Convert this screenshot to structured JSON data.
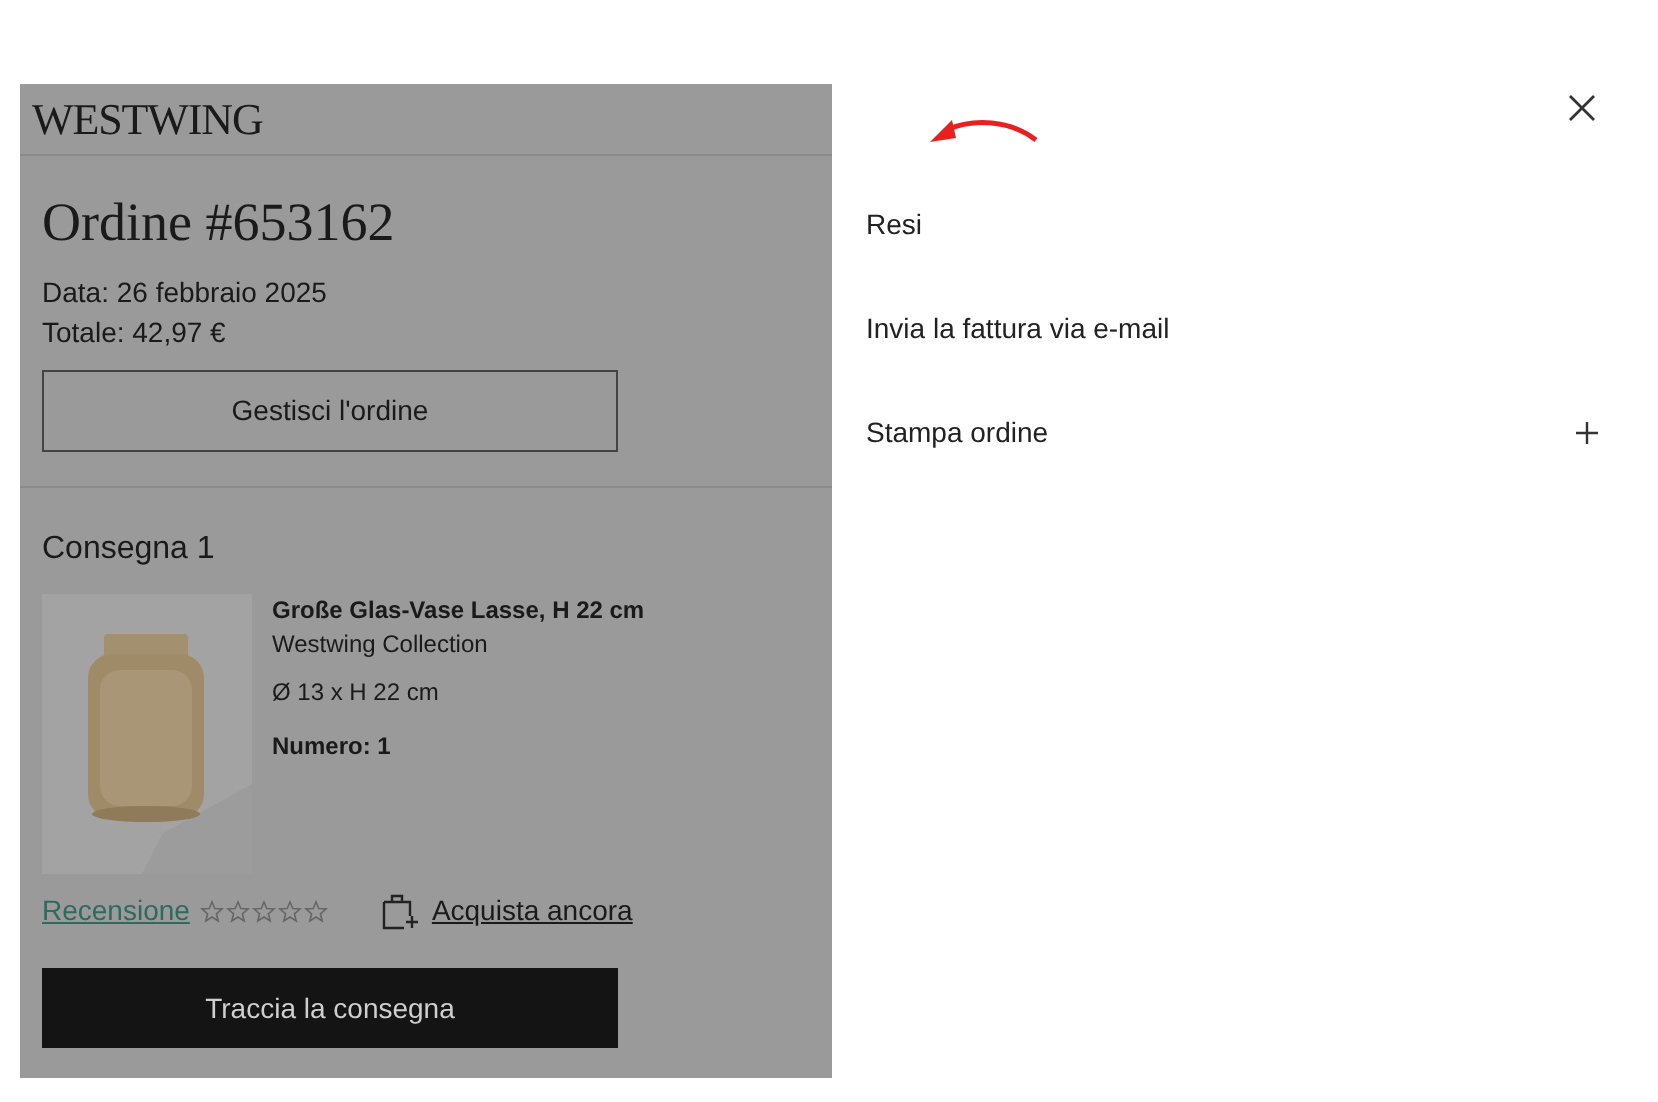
{
  "logo": "WESTWING",
  "order": {
    "title": "Ordine #653162",
    "date": "Data: 26 febbraio 2025",
    "total": "Totale: 42,97 €",
    "manage_button": "Gestisci l'ordine"
  },
  "delivery": {
    "title": "Consegna 1",
    "product": {
      "name": "Große Glas-Vase Lasse, H 22 cm",
      "brand": "Westwing Collection",
      "size": "Ø 13 x H 22 cm",
      "quantity": "Numero: 1"
    },
    "review_link": "Recensione",
    "stars": 0,
    "buy_again_link": "Acquista ancora",
    "track_button": "Traccia la consegna"
  },
  "menu": {
    "items": [
      {
        "label": "Resi",
        "expandable": false
      },
      {
        "label": "Invia la fattura via e-mail",
        "expandable": false
      },
      {
        "label": "Stampa ordine",
        "expandable": true
      }
    ]
  }
}
